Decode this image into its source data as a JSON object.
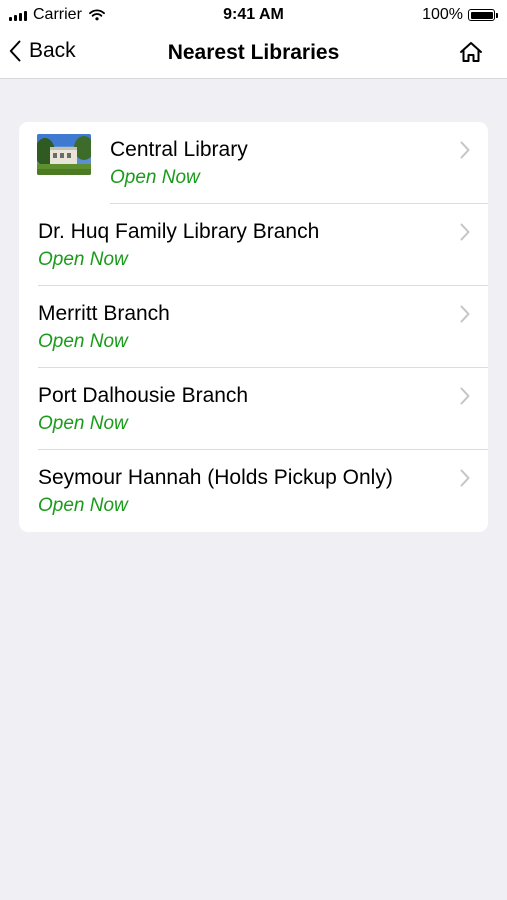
{
  "status_bar": {
    "carrier": "Carrier",
    "time": "9:41 AM",
    "battery": "100%",
    "icons": [
      "signal-icon",
      "wifi-icon",
      "battery-icon"
    ]
  },
  "nav": {
    "back_label": "Back",
    "title": "Nearest Libraries",
    "home_icon": "home-icon"
  },
  "libraries": [
    {
      "name": "Central Library",
      "status": "Open Now",
      "has_thumbnail": true
    },
    {
      "name": "Dr. Huq Family Library Branch",
      "status": "Open Now"
    },
    {
      "name": "Merritt Branch",
      "status": "Open Now"
    },
    {
      "name": "Port Dalhousie Branch",
      "status": "Open Now"
    },
    {
      "name": "Seymour Hannah (Holds Pickup Only)",
      "status": "Open Now"
    }
  ],
  "colors": {
    "background": "#efeff4",
    "status_open": "#1a9b1a",
    "chevron": "#c4c4c8"
  }
}
